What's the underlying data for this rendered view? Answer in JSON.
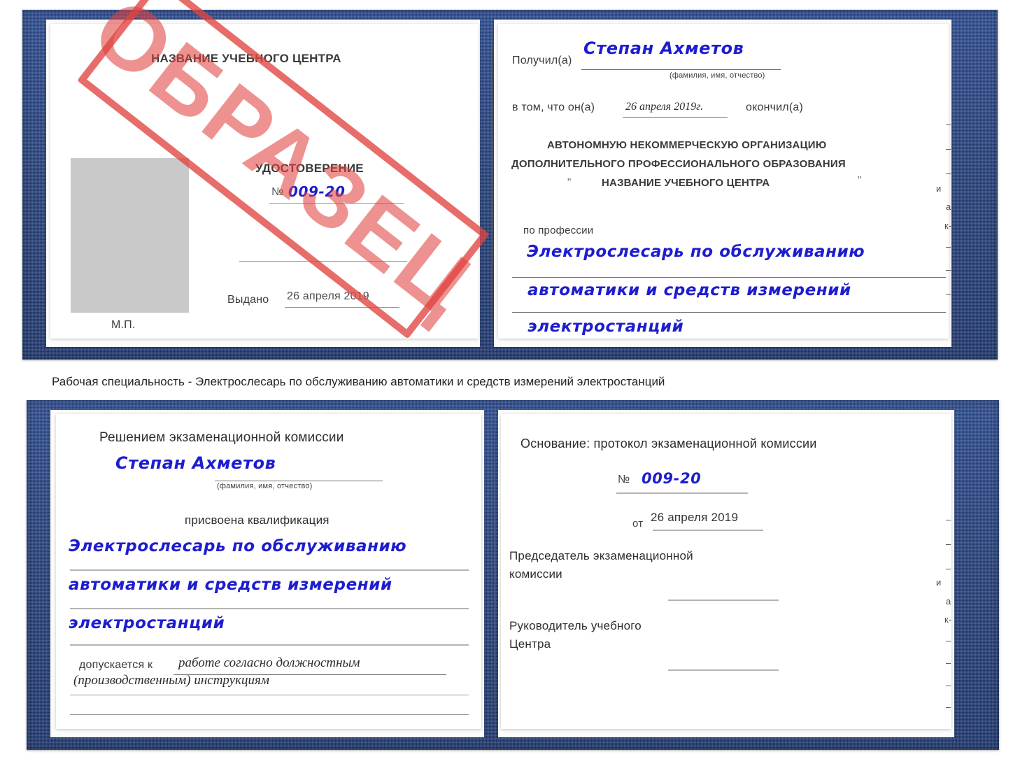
{
  "document": {
    "type": "certificate-scan",
    "stamp_label": "ОБРАЗЕЦ",
    "stamp_color": "#e04440",
    "handwriting_color": "#1d1dcf",
    "cover_color": "#27437f"
  },
  "caption": {
    "text": "Рабочая специальность - Электрослесарь по обслуживанию автоматики и средств измерений электростанций"
  },
  "top_certificate": {
    "left_page": {
      "header": "НАЗВАНИЕ УЧЕБНОГО ЦЕНТРА",
      "title": "УДОСТОВЕРЕНИЕ",
      "number_label": "№",
      "number_value": "009-20",
      "issued_label": "Выдано",
      "issued_value": "26 апреля 2019",
      "seal_label": "М.П.",
      "photo_placeholder": "photo-placeholder"
    },
    "right_page": {
      "received_label": "Получил(а)",
      "received_value": "Степан Ахметов",
      "fio_hint": "(фамилия, имя, отчество)",
      "that_he_label": "в том, что он(а)",
      "completion_date": "26 апреля 2019г.",
      "finished_label": "окончил(а)",
      "org_line1": "АВТОНОМНУЮ НЕКОММЕРЧЕСКУЮ ОРГАНИЗАЦИЮ",
      "org_line2": "ДОПОЛНИТЕЛЬНОГО ПРОФЕССИОНАЛЬНОГО ОБРАЗОВАНИЯ",
      "org_quote_open": "\"",
      "org_name": "НАЗВАНИЕ УЧЕБНОГО ЦЕНТРА",
      "org_quote_close": "\"",
      "profession_label": "по профессии",
      "profession_line1": "Электрослесарь по обслуживанию",
      "profession_line2": "автоматики и средств измерений",
      "profession_line3": "электростанций"
    }
  },
  "bottom_certificate": {
    "left_page": {
      "heading": "Решением экзаменационной комиссии",
      "name_value": "Степан Ахметов",
      "fio_hint": "(фамилия, имя, отчество)",
      "qualification_label": "присвоена квалификация",
      "qualification_line1": "Электрослесарь по обслуживанию",
      "qualification_line2": "автоматики и средств измерений",
      "qualification_line3": "электростанций",
      "admitted_label": "допускается к",
      "admitted_value_line1": "работе согласно должностным",
      "admitted_value_line2": "(производственным) инструкциям"
    },
    "right_page": {
      "basis_label": "Основание: протокол экзаменационной комиссии",
      "number_label": "№",
      "number_value": "009-20",
      "date_label": "от",
      "date_value": "26 апреля 2019",
      "chairman_line1": "Председатель экзаменационной",
      "chairman_line2": "комиссии",
      "head_line1": "Руководитель учебного",
      "head_line2": "Центра"
    }
  },
  "edge_fragments": {
    "top": [
      "–",
      "–",
      "–",
      "и",
      "а",
      "к-",
      "–",
      "–",
      "–"
    ],
    "bottom": [
      "–",
      "–",
      "–",
      "и",
      "а",
      "к-",
      "–",
      "–",
      "–",
      "–"
    ]
  }
}
